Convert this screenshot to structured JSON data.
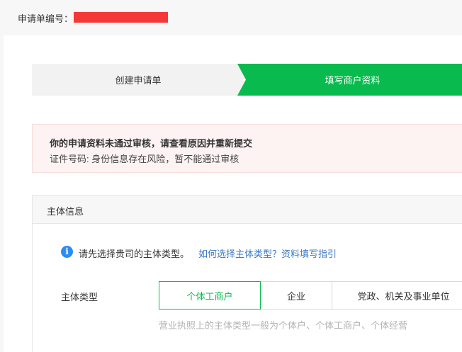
{
  "header": {
    "app_no_label": "申请单编号：",
    "app_no_value": "",
    "redaction_color": "#f43838"
  },
  "steps": [
    {
      "label": "创建申请单",
      "state": "done"
    },
    {
      "label": "填写商户资料",
      "state": "active"
    }
  ],
  "alert": {
    "title": "你的申请资料未通过审核，请查看原因并重新提交",
    "detail": "证件号码: 身份信息存在风险，暂不能通过审核"
  },
  "section": {
    "title": "主体信息",
    "info_icon": "info-icon",
    "info_text": "请先选择贵司的主体类型。",
    "info_link": "如何选择主体类型？资料填写指引",
    "field_label": "主体类型",
    "options": [
      "个体工商户",
      "企业",
      "党政、机关及事业单位"
    ],
    "selected": "个体工商户",
    "hint": "营业执照上的主体类型一般为个体户、个体工商户、个体经营"
  },
  "colors": {
    "accent": "#09bb4f",
    "link": "#3b78c4",
    "alert_bg": "#fdf3f2",
    "info": "#2d8cf0"
  }
}
